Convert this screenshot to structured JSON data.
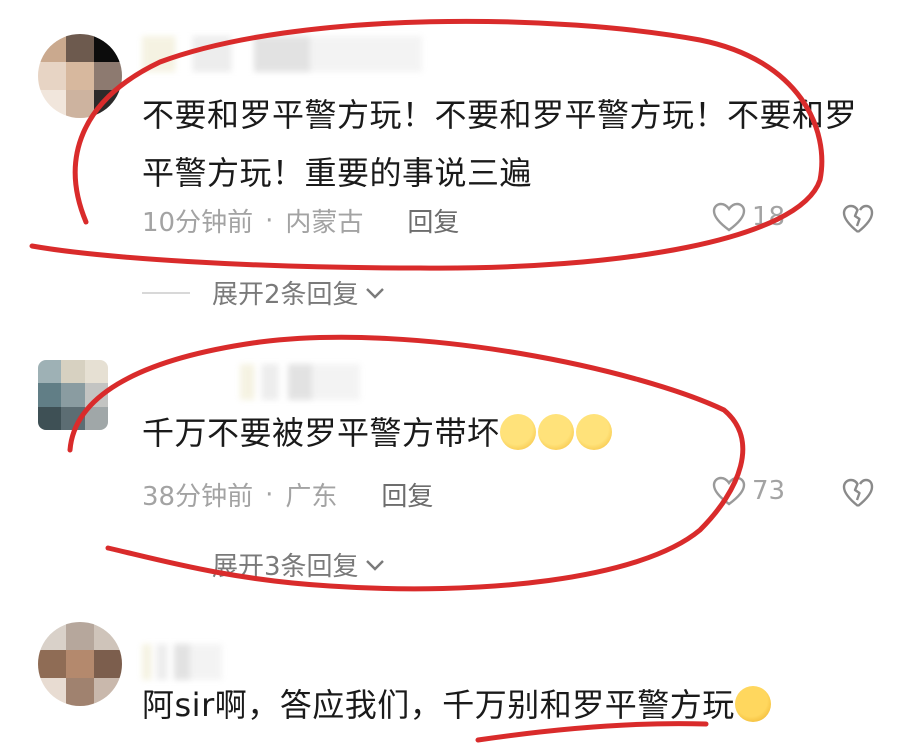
{
  "comments": [
    {
      "text": "不要和罗平警方玩！不要和罗平警方玩！不要和罗平警方玩！重要的事说三遍",
      "time": "10分钟前",
      "location": "内蒙古",
      "reply_label": "回复",
      "likes": "18",
      "expand_label": "展开2条回复"
    },
    {
      "text": "千万不要被罗平警方带坏",
      "emojis": [
        "heart-eyes-kiss-emoji",
        "heart-eyes-kiss-emoji",
        "heart-eyes-kiss-emoji"
      ],
      "time": "38分钟前",
      "location": "广东",
      "reply_label": "回复",
      "likes": "73",
      "expand_label": "展开3条回复"
    },
    {
      "text": "阿sir啊，答应我们，千万别和罗平警方玩",
      "emojis": [
        "crying-emoji"
      ]
    }
  ],
  "separator": "·",
  "annotation_color": "#d92b2b",
  "icons": [
    "heart-outline-icon",
    "broken-heart-icon",
    "chevron-down-icon"
  ]
}
